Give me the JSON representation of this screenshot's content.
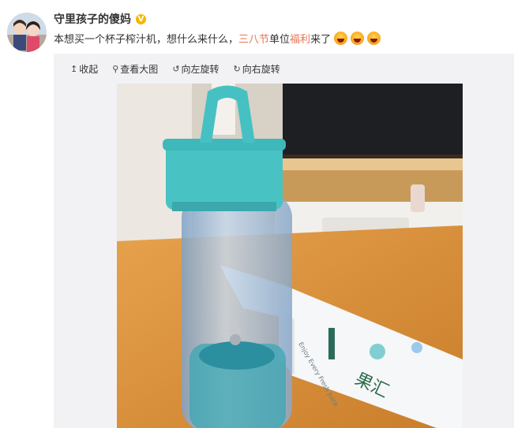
{
  "post": {
    "username": "守里孩子的傻妈",
    "verify_mark": "V",
    "text_before": "本想买一个杯子榨汁机，想什么来什么，",
    "highlight_1": "三八节",
    "text_middle": "单位",
    "highlight_2": "福利",
    "text_after": "来了",
    "emoji_count": 3
  },
  "toolbar": {
    "collapse": "收起",
    "view_large": "查看大图",
    "rotate_left": "向左旋转",
    "rotate_right": "向右旋转"
  },
  "photo": {
    "box_text": "果汇",
    "box_small_text": "Enjoy Every Fresh Juice"
  },
  "colors": {
    "highlight": "#eb7350",
    "verify": "#f7b500",
    "panel": "#f2f2f5"
  },
  "icons": {
    "collapse": "arrow-up-icon",
    "view_large": "magnifier-icon",
    "rotate_left": "rotate-left-icon",
    "rotate_right": "rotate-right-icon"
  }
}
